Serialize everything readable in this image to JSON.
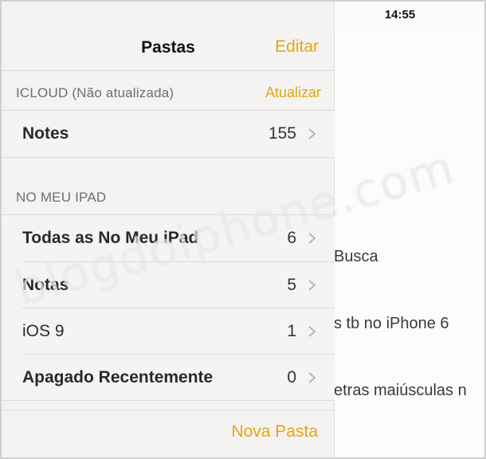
{
  "status_bar": {
    "device": "iPad",
    "time": "14:55"
  },
  "sidebar": {
    "title": "Pastas",
    "edit_label": "Editar",
    "sections": [
      {
        "header": "ICLOUD (Não atualizada)",
        "action": "Atualizar",
        "rows": [
          {
            "label": "Notes",
            "count": "155"
          }
        ]
      },
      {
        "header": "NO MEU IPAD",
        "rows": [
          {
            "label": "Todas as No Meu iPad",
            "count": "6"
          },
          {
            "label": "Notas",
            "count": "5"
          },
          {
            "label": "iOS 9",
            "count": "1"
          },
          {
            "label": "Apagado Recentemente",
            "count": "0"
          }
        ]
      }
    ],
    "new_folder_label": "Nova Pasta"
  },
  "note_preview": {
    "lines": [
      "Busca",
      "s tb no iPhone 6",
      "etras maiúsculas n"
    ]
  },
  "watermark": "blogdoiphone.com",
  "colors": {
    "accent": "#e3a512",
    "sidebar_bg": "#f4f3f1"
  }
}
